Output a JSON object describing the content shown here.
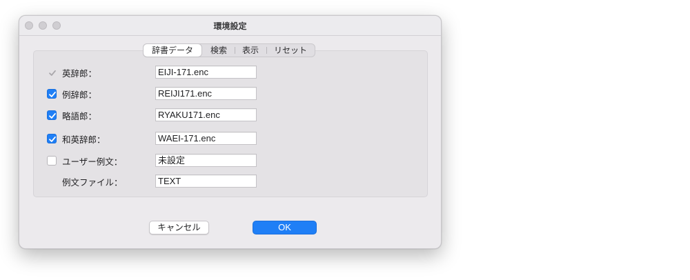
{
  "window": {
    "title": "環境設定"
  },
  "tabs": [
    {
      "label": "辞書データ",
      "selected": true
    },
    {
      "label": "検索",
      "selected": false
    },
    {
      "label": "表示",
      "selected": false
    },
    {
      "label": "リセット",
      "selected": false
    }
  ],
  "rows": [
    {
      "label": "英辞郎：",
      "value": "EIJI-171.enc",
      "checkbox": "checked-disabled"
    },
    {
      "label": "例辞郎：",
      "value": "REIJI171.enc",
      "checkbox": "checked"
    },
    {
      "label": "略語郎：",
      "value": "RYAKU171.enc",
      "checkbox": "checked"
    },
    {
      "label": "和英辞郎：",
      "value": "WAEI-171.enc",
      "checkbox": "checked"
    },
    {
      "label": "ユーザー例文：",
      "value": "未設定",
      "checkbox": "unchecked"
    },
    {
      "label": "例文ファイル：",
      "value": "TEXT",
      "checkbox": "none"
    }
  ],
  "buttons": {
    "cancel": "キャンセル",
    "ok": "OK"
  },
  "colors": {
    "accent": "#1f7ff6",
    "window_bg": "#eceaed",
    "group_bg": "#e4e2e5"
  }
}
